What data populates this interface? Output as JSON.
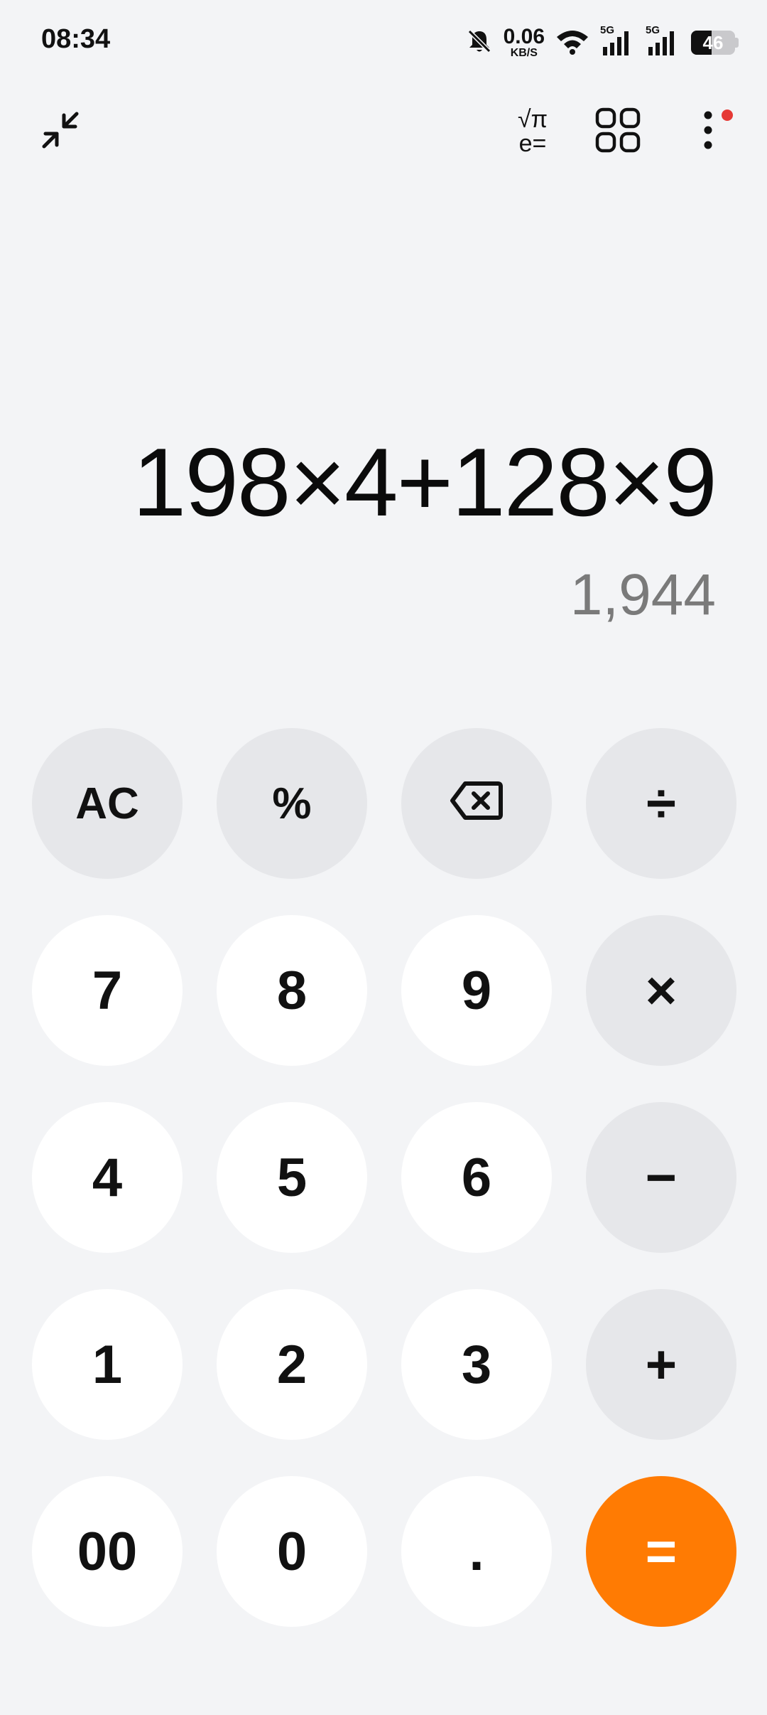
{
  "status_bar": {
    "time": "08:34",
    "net_speed_value": "0.06",
    "net_speed_unit": "KB/S",
    "sim1_label": "5G",
    "sim2_label": "5G",
    "battery": "46",
    "battery_level": 0.46
  },
  "toolbar": {
    "sci_top": "√π",
    "sci_bottom": "e="
  },
  "display": {
    "expression": "198×4+128×9",
    "result": "1,944"
  },
  "keys": {
    "ac": "AC",
    "percent": "%",
    "divide": "÷",
    "seven": "7",
    "eight": "8",
    "nine": "9",
    "multiply": "×",
    "four": "4",
    "five": "5",
    "six": "6",
    "minus": "−",
    "one": "1",
    "two": "2",
    "three": "3",
    "plus": "+",
    "double_zero": "00",
    "zero": "0",
    "decimal": ".",
    "equals": "="
  },
  "colors": {
    "equals_accent": "#ff7b03",
    "notification_dot": "#e53935",
    "operator_key": "#e6e7ea",
    "number_key": "#ffffff"
  }
}
